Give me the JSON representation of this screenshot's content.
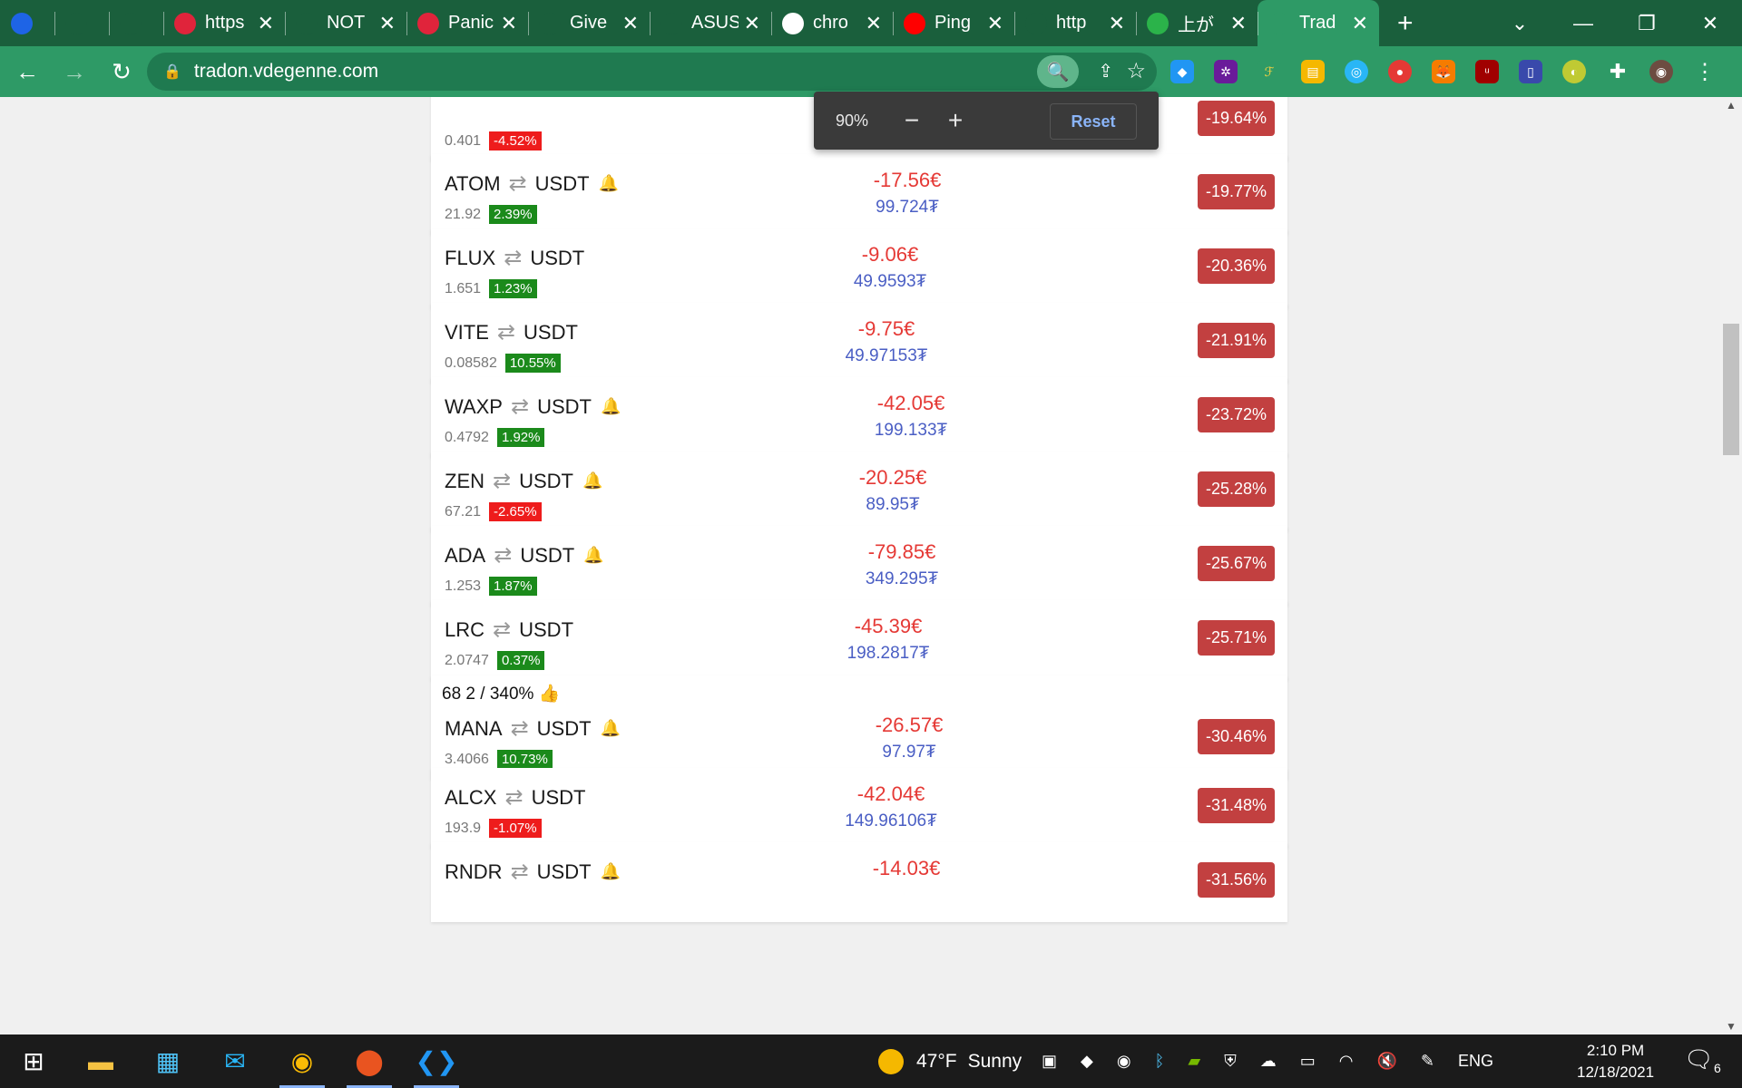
{
  "browser": {
    "tabs": [
      {
        "title": "",
        "favicon": "coinmarketcap-icon",
        "color": "#1e64e6"
      },
      {
        "title": "",
        "favicon": "diamond-icon",
        "color": "#1a5f3c"
      },
      {
        "title": "",
        "favicon": "binance-icon",
        "color": "#1a5f3c"
      },
      {
        "title": "https",
        "favicon": "r-icon",
        "color": "#e0243b"
      },
      {
        "title": "NOT",
        "favicon": "globe-icon",
        "color": "#1a5f3c"
      },
      {
        "title": "Panic",
        "favicon": "panic-icon",
        "color": "#e0243b"
      },
      {
        "title": "Give",
        "favicon": "globe-icon",
        "color": "#1a5f3c"
      },
      {
        "title": "ASUS",
        "favicon": "asus-icon",
        "color": "#1a5f3c"
      },
      {
        "title": "chro",
        "favicon": "google-icon",
        "color": "#ffffff"
      },
      {
        "title": "Ping",
        "favicon": "youtube-icon",
        "color": "#ff0000"
      },
      {
        "title": "http",
        "favicon": "globe-icon",
        "color": "#1a5f3c"
      },
      {
        "title": "上が",
        "favicon": "green-square-icon",
        "color": "#2bb34a"
      },
      {
        "title": "Trad",
        "favicon": "tradon-icon",
        "color": "#2e9a66"
      }
    ],
    "url": "tradon.vdegenne.com",
    "zoom_popup": {
      "level": "90%",
      "reset_label": "Reset"
    }
  },
  "trades": [
    {
      "coin": "",
      "quote": "",
      "bell": "",
      "price": "0.401",
      "change": "-4.52%",
      "change_dir": "down",
      "eur": "",
      "usdt": "",
      "pct": "-19.64%"
    },
    {
      "coin": "ATOM",
      "quote": "USDT",
      "bell": "red",
      "price": "21.92",
      "change": "2.39%",
      "change_dir": "up",
      "eur": "-17.56€",
      "usdt": "99.724₮",
      "pct": "-19.77%"
    },
    {
      "coin": "FLUX",
      "quote": "USDT",
      "bell": "",
      "price": "1.651",
      "change": "1.23%",
      "change_dir": "up",
      "eur": "-9.06€",
      "usdt": "49.9593₮",
      "pct": "-20.36%"
    },
    {
      "coin": "VITE",
      "quote": "USDT",
      "bell": "",
      "price": "0.08582",
      "change": "10.55%",
      "change_dir": "up",
      "eur": "-9.75€",
      "usdt": "49.97153₮",
      "pct": "-21.91%"
    },
    {
      "coin": "WAXP",
      "quote": "USDT",
      "bell": "red",
      "price": "0.4792",
      "change": "1.92%",
      "change_dir": "up",
      "eur": "-42.05€",
      "usdt": "199.133₮",
      "pct": "-23.72%"
    },
    {
      "coin": "ZEN",
      "quote": "USDT",
      "bell": "red",
      "price": "67.21",
      "change": "-2.65%",
      "change_dir": "down",
      "eur": "-20.25€",
      "usdt": "89.95₮",
      "pct": "-25.28%"
    },
    {
      "coin": "ADA",
      "quote": "USDT",
      "bell": "black",
      "price": "1.253",
      "change": "1.87%",
      "change_dir": "up",
      "eur": "-79.85€",
      "usdt": "349.295₮",
      "pct": "-25.67%"
    },
    {
      "coin": "LRC",
      "quote": "USDT",
      "bell": "",
      "price": "2.0747",
      "change": "0.37%",
      "change_dir": "up",
      "eur": "-45.39€",
      "usdt": "198.2817₮",
      "pct": "-25.71%"
    },
    {
      "coin": "MANA",
      "quote": "USDT",
      "bell": "red",
      "price": "3.4066",
      "change": "10.73%",
      "change_dir": "up",
      "eur": "-26.57€",
      "usdt": "97.97₮",
      "pct": "-30.46%",
      "note": "68 2 / 340% 👍"
    },
    {
      "coin": "ALCX",
      "quote": "USDT",
      "bell": "",
      "price": "193.9",
      "change": "-1.07%",
      "change_dir": "down",
      "eur": "-42.04€",
      "usdt": "149.96106₮",
      "pct": "-31.48%"
    },
    {
      "coin": "RNDR",
      "quote": "USDT",
      "bell": "black",
      "price": "",
      "change": "",
      "change_dir": "",
      "eur": "-14.03€",
      "usdt": "",
      "pct": "-31.56%"
    }
  ],
  "taskbar": {
    "weather_temp": "47°F",
    "weather_desc": "Sunny",
    "language": "ENG",
    "time": "2:10 PM",
    "date": "12/18/2021",
    "notifications": "6"
  }
}
